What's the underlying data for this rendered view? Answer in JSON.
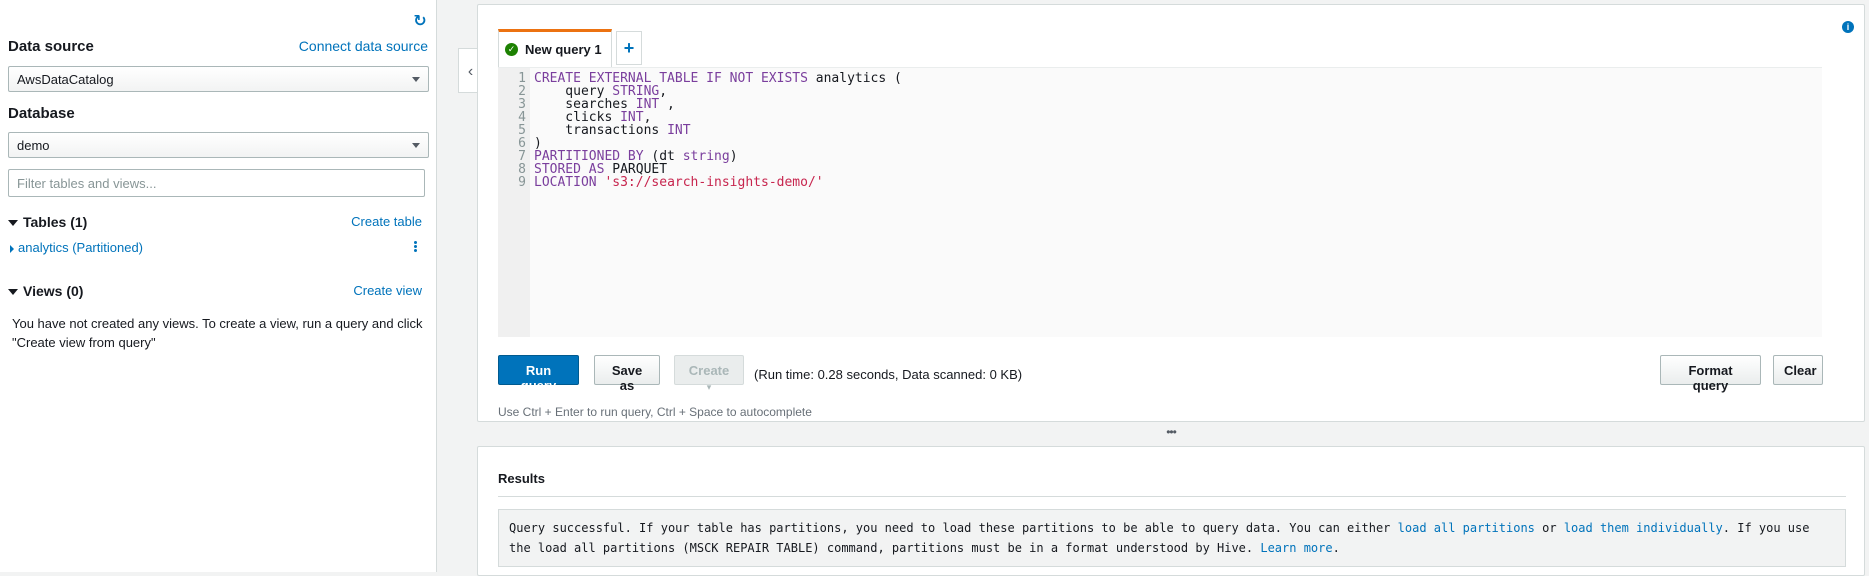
{
  "sidebar": {
    "data_source_label": "Data source",
    "connect_link": "Connect data source",
    "data_source_value": "AwsDataCatalog",
    "database_label": "Database",
    "database_value": "demo",
    "filter_placeholder": "Filter tables and views...",
    "tables_title": "Tables (1)",
    "create_table_link": "Create table",
    "table_item": "analytics (Partitioned)",
    "views_title": "Views (0)",
    "create_view_link": "Create view",
    "views_empty": "You have not created any views. To create a view, run a query and click \"Create view from query\""
  },
  "editor": {
    "tab_label": "New query 1",
    "add_tab": "+",
    "line_numbers": [
      "1",
      "2",
      "3",
      "4",
      "5",
      "6",
      "7",
      "8",
      "9"
    ],
    "code": {
      "l1_kw": "CREATE EXTERNAL TABLE IF NOT EXISTS",
      "l1_rest": " analytics (",
      "l2_pre": "    query ",
      "l2_kw": "STRING",
      "l2_post": ",",
      "l3_pre": "    searches ",
      "l3_kw": "INT",
      "l3_post": " ,",
      "l4_pre": "    clicks ",
      "l4_kw": "INT",
      "l4_post": ",",
      "l5_pre": "    transactions ",
      "l5_kw": "INT",
      "l6": ")",
      "l7_kw": "PARTITIONED BY",
      "l7_mid": " (dt ",
      "l7_kw2": "string",
      "l7_post": ")",
      "l8_kw": "STORED AS",
      "l8_rest": " PARQUET",
      "l9_kw": "LOCATION",
      "l9_str": "'s3://search-insights-demo/'"
    },
    "run_button": "Run query",
    "save_button": "Save as",
    "create_button": "Create",
    "run_info": "(Run time: 0.28 seconds, Data scanned: 0 KB)",
    "format_button": "Format query",
    "clear_button": "Clear",
    "hint": "Use Ctrl + Enter to run query, Ctrl + Space to autocomplete"
  },
  "results": {
    "title": "Results",
    "msg_1": "Query successful. If your table has partitions, you need to load these partitions to be able to query data. You can either ",
    "link_1": "load all partitions",
    "msg_2": " or ",
    "link_2": "load them individually",
    "msg_3": ". If you use the load all partitions (MSCK REPAIR TABLE) command, partitions must be in a format understood by Hive. ",
    "link_3": "Learn more",
    "msg_4": "."
  },
  "colors": {
    "accent": "#0073bb",
    "tab_highlight": "#ec7211",
    "success": "#1d8102"
  }
}
